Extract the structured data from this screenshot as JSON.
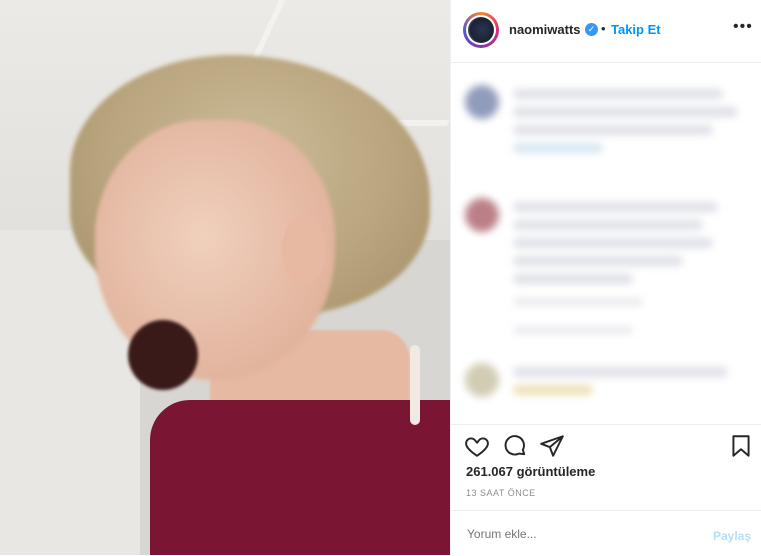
{
  "header": {
    "username": "naomiwatts",
    "separator": "•",
    "follow_label": "Takip Et",
    "more_label": "•••",
    "verified_icon": "✓"
  },
  "stats": {
    "views": "261.067 görüntüleme",
    "time_ago": "13 SAAT ÖNCE"
  },
  "comment_box": {
    "placeholder": "Yorum ekle...",
    "post_label": "Paylaş"
  },
  "icons": [
    "heart-icon",
    "comment-icon",
    "share-icon",
    "bookmark-icon",
    "verified-icon",
    "more-icon"
  ],
  "colors": {
    "accent": "#0095f6",
    "text": "#262626",
    "muted": "#8e8e8e",
    "post_disabled": "#b2dffc"
  }
}
